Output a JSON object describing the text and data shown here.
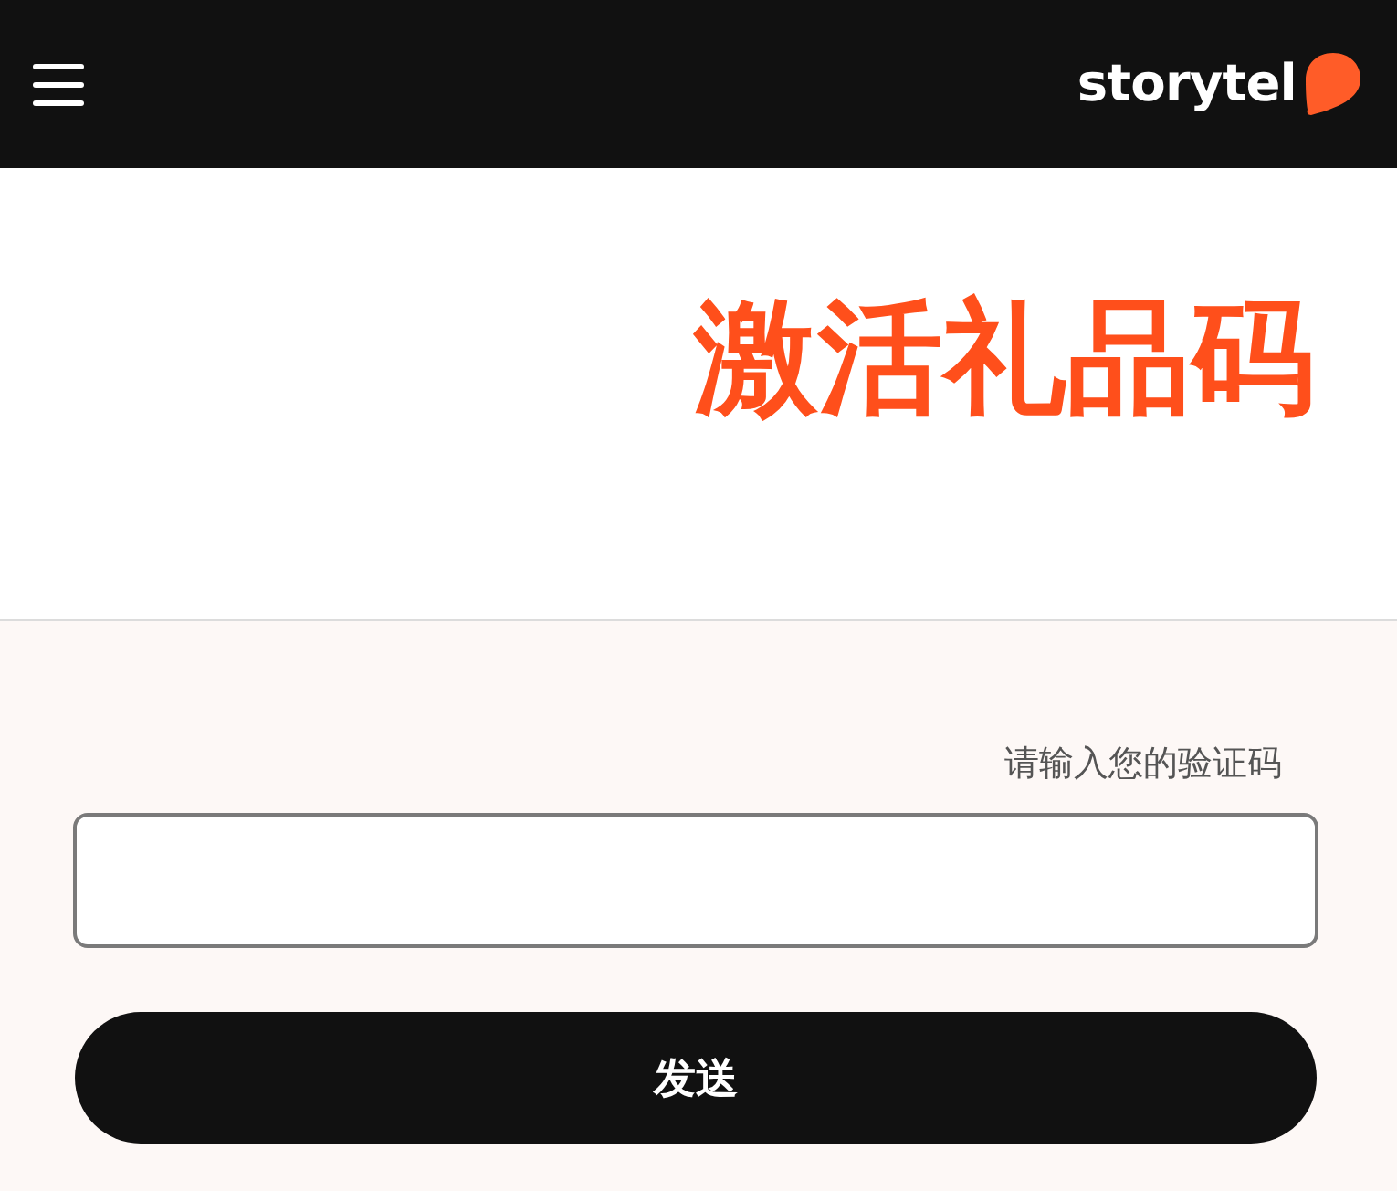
{
  "header": {
    "brand": "storytel"
  },
  "title": "激活礼品码",
  "form": {
    "label": "请输入您的验证码",
    "submit_button": {
      "label": "发送"
    }
  }
}
